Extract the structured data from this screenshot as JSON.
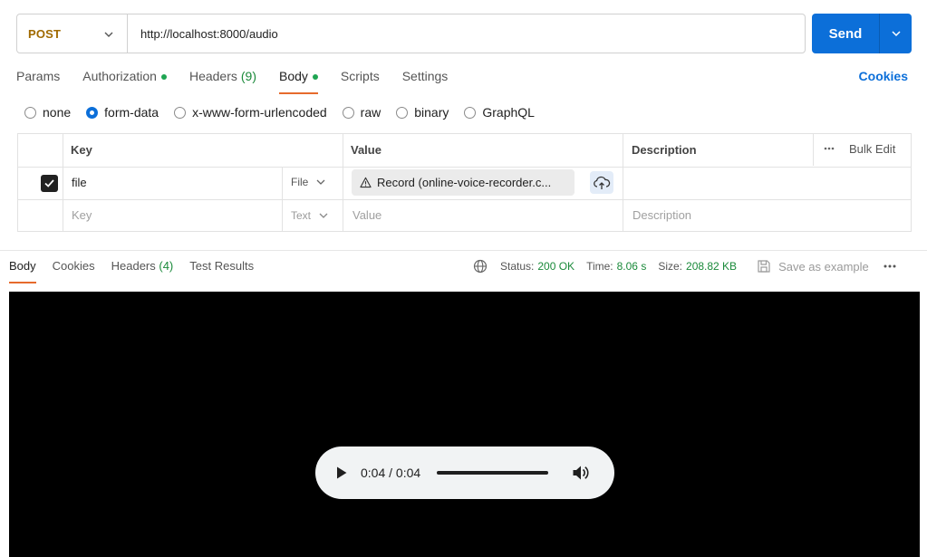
{
  "request": {
    "method": "POST",
    "url": "http://localhost:8000/audio",
    "send_label": "Send"
  },
  "request_tabs": [
    {
      "label": "Params"
    },
    {
      "label": "Authorization",
      "dot": true
    },
    {
      "label": "Headers",
      "count": "(9)"
    },
    {
      "label": "Body",
      "dot": true,
      "active": true
    },
    {
      "label": "Scripts"
    },
    {
      "label": "Settings"
    }
  ],
  "cookies_link": "Cookies",
  "body_types": {
    "none": "none",
    "form_data": "form-data",
    "urlencoded": "x-www-form-urlencoded",
    "raw": "raw",
    "binary": "binary",
    "graphql": "GraphQL",
    "selected": "form-data"
  },
  "table": {
    "headers": {
      "key": "Key",
      "value": "Value",
      "description": "Description",
      "bulk_edit": "Bulk Edit"
    },
    "row1": {
      "checked": true,
      "key": "file",
      "type": "File",
      "value": "Record (online-voice-recorder.c..."
    },
    "row2": {
      "key_placeholder": "Key",
      "type": "Text",
      "value_placeholder": "Value",
      "description_placeholder": "Description"
    }
  },
  "response_tabs": {
    "body": "Body",
    "cookies": "Cookies",
    "headers": "Headers",
    "headers_count": "(4)",
    "test_results": "Test Results"
  },
  "response_meta": {
    "status_label": "Status:",
    "status_value": "200 OK",
    "time_label": "Time:",
    "time_value": "8.06 s",
    "size_label": "Size:",
    "size_value": "208.82 KB",
    "save_label": "Save as example"
  },
  "player": {
    "time": "0:04 / 0:04",
    "progress": 1.0
  },
  "colors": {
    "accent": "#0c6fd9",
    "method": "#a06a00",
    "success": "#1a8a3a",
    "active_tab": "#e66a2c"
  }
}
